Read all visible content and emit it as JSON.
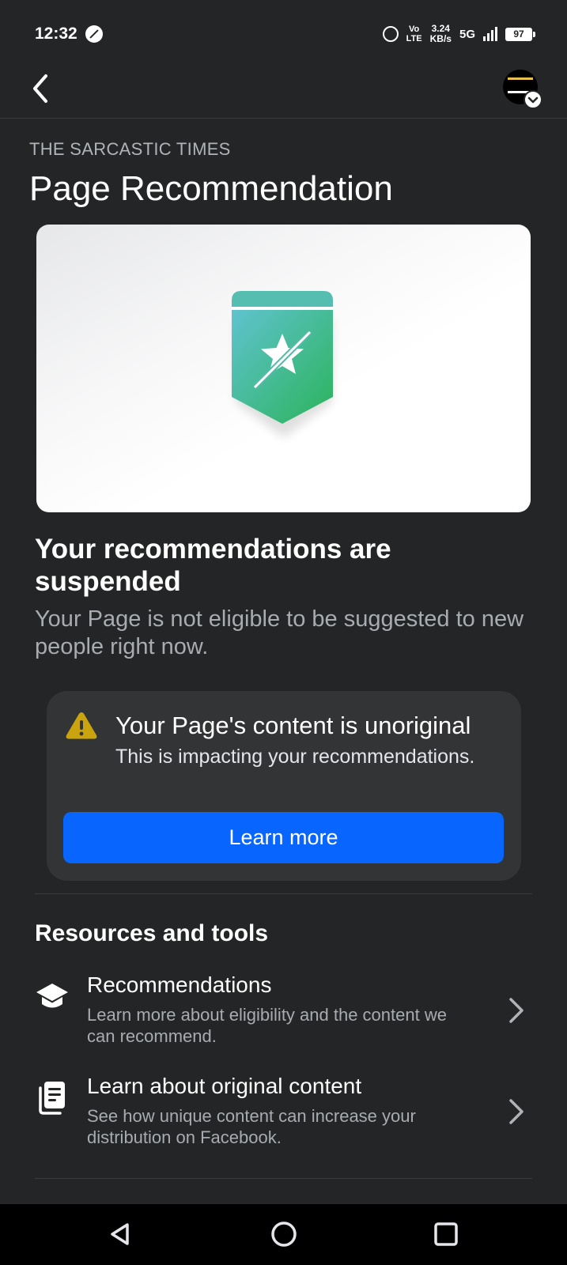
{
  "status_bar": {
    "time": "12:32",
    "volte_top": "Vo",
    "volte_bottom": "LTE",
    "speed_value": "3.24",
    "speed_unit": "KB/s",
    "network": "5G",
    "battery": "97"
  },
  "header": {
    "back_icon": "chevron-left-icon",
    "avatar_icon": "page-avatar"
  },
  "page": {
    "page_name": "THE SARCASTIC TIMES",
    "title": "Page Recommendation"
  },
  "hero": {
    "icon": "recommendation-suspended-badge-icon",
    "colors": {
      "badge_teal": "#5bc0c8",
      "badge_green": "#2bb35a"
    }
  },
  "status": {
    "headline": "Your recommendations are suspended",
    "subline": "Your Page is not eligible to be suggested to new people right now."
  },
  "notice": {
    "icon": "warning-icon",
    "title": "Your Page's content is unoriginal",
    "body": "This is impacting your recommendations.",
    "button_label": "Learn more",
    "colors": {
      "button": "#0866ff",
      "warning": "#c9a40e"
    }
  },
  "resources": {
    "section_title": "Resources and tools",
    "items": [
      {
        "icon": "graduation-cap-icon",
        "title": "Recommendations",
        "description": "Learn more about eligibility and the content we can recommend."
      },
      {
        "icon": "documents-icon",
        "title": "Learn about original content",
        "description": "See how unique content can increase your distribution on Facebook."
      }
    ]
  },
  "system_nav": {
    "back": "triangle-back-icon",
    "home": "circle-home-icon",
    "recents": "square-recents-icon"
  }
}
